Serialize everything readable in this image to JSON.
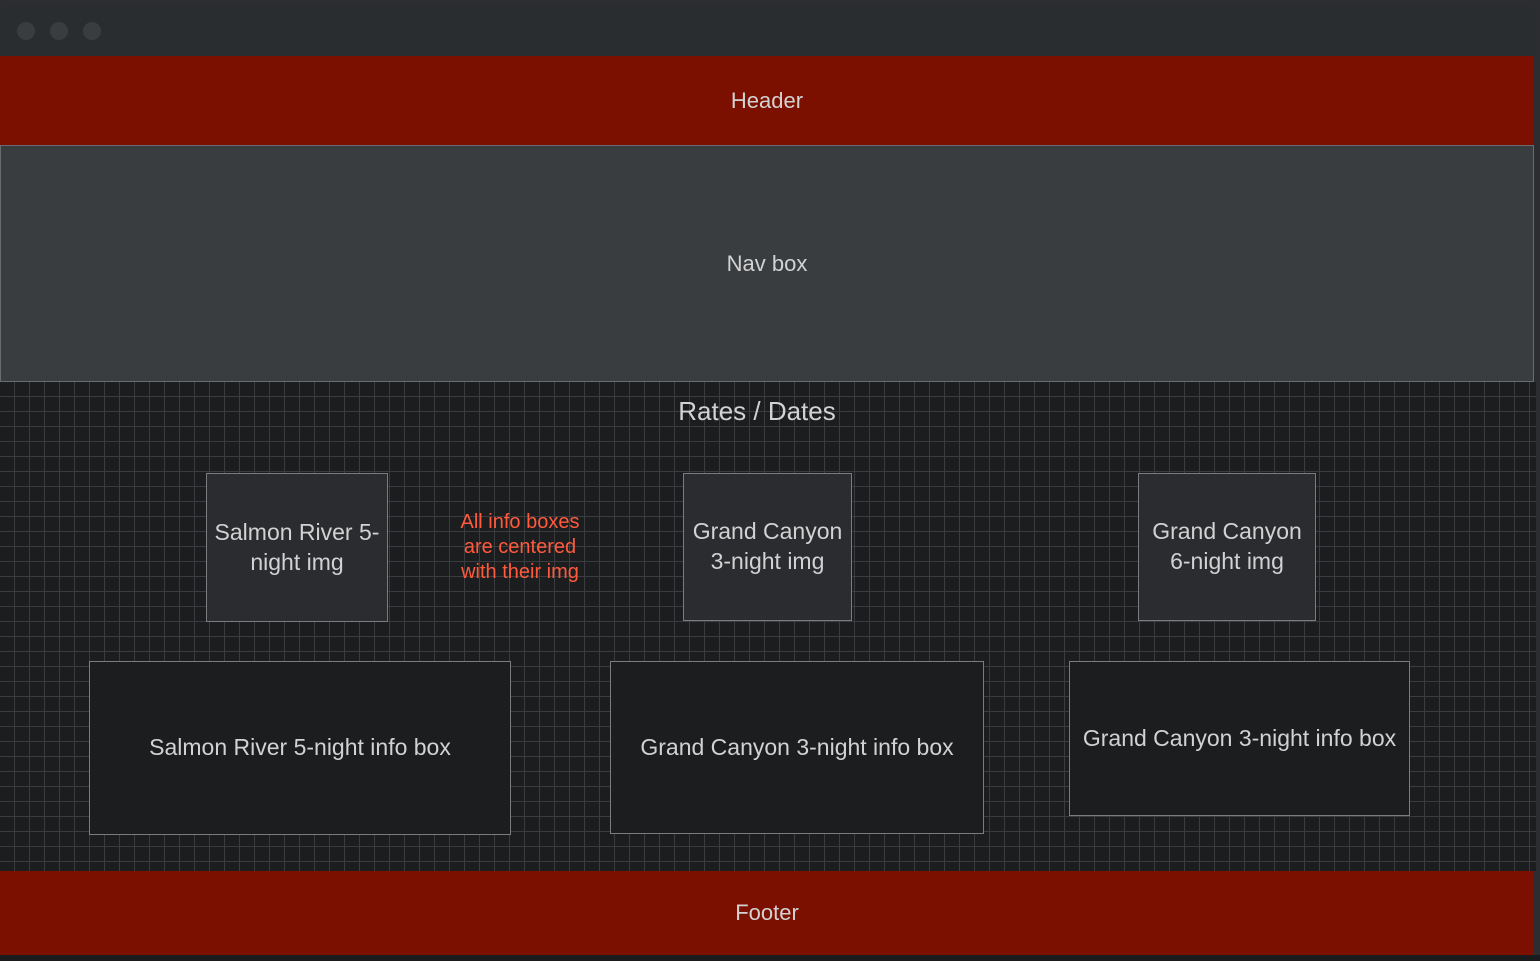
{
  "header": {
    "label": "Header"
  },
  "nav": {
    "label": "Nav box"
  },
  "main": {
    "title": "Rates / Dates",
    "note": "All info boxes are centered with their img",
    "images": [
      {
        "label": "Salmon River 5-night img"
      },
      {
        "label": "Grand Canyon 3-night img"
      },
      {
        "label": "Grand Canyon 6-night img"
      }
    ],
    "info_boxes": [
      {
        "label": "Salmon River 5-night info box"
      },
      {
        "label": "Grand Canyon 3-night info box"
      },
      {
        "label": "Grand Canyon 3-night info box"
      }
    ]
  },
  "footer": {
    "label": "Footer"
  },
  "colors": {
    "header_footer": "#7c1000",
    "nav": "#3a3d40",
    "note": "#ff5a3c",
    "text": "#d2d2d2"
  }
}
